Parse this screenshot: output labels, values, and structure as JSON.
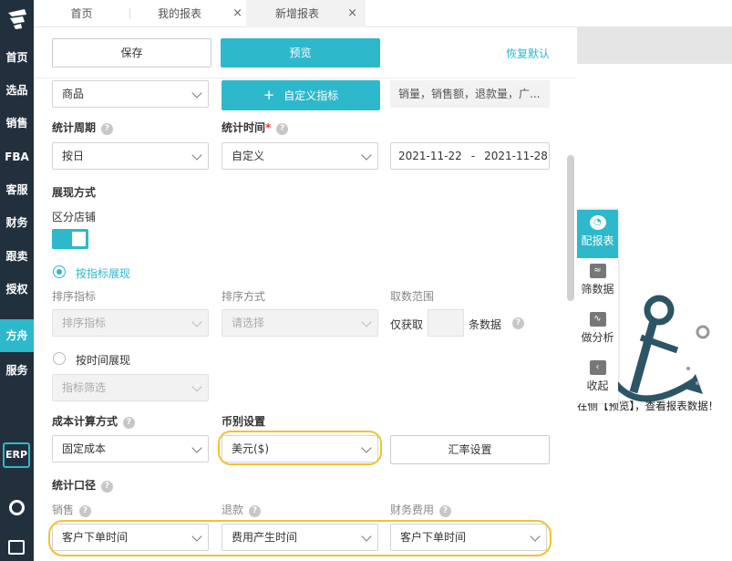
{
  "sidebar": {
    "items": [
      "首页",
      "选品",
      "销售",
      "FBA",
      "客服",
      "财务",
      "跟卖",
      "授权",
      "方舟",
      "服务"
    ],
    "active": "方舟",
    "erp": "ERP"
  },
  "tabs": [
    {
      "label": "首页"
    },
    {
      "label": "我的报表"
    },
    {
      "label": "新增报表"
    }
  ],
  "tab_close": "×",
  "toolbar": {
    "save": "保存",
    "preview": "预览",
    "reset": "恢复默认"
  },
  "row1": {
    "product": "商品",
    "custom_metric": "自定义指标",
    "plus": "+",
    "metrics_hint": "销量，销售额，退款量，广..."
  },
  "period": {
    "label": "统计周期",
    "value": "按日"
  },
  "time": {
    "label": "统计时间",
    "required": "*",
    "value": "自定义",
    "start": "2021-11-22",
    "sep": "-",
    "end": "2021-11-28"
  },
  "display": {
    "label": "展现方式",
    "split_store": "区分店铺"
  },
  "by_metric": {
    "label": "按指标展现",
    "sort_metric_label": "排序指标",
    "sort_metric_value": "排序指标",
    "sort_method_label": "排序方式",
    "sort_method_placeholder": "请选择",
    "range_label": "取数范围",
    "only_take": "仅获取",
    "count_suffix": "条数据"
  },
  "by_time": {
    "label": "按时间展现",
    "filter_placeholder": "指标筛选"
  },
  "cost": {
    "label": "成本计算方式",
    "value": "固定成本"
  },
  "currency": {
    "label": "币别设置",
    "value": "美元($)",
    "rate_button": "汇率设置"
  },
  "stat": {
    "label": "统计口径",
    "sales_label": "销售",
    "sales_value": "客户下单时间",
    "refund_label": "退款",
    "refund_value": "费用产生时间",
    "fin_label": "财务费用",
    "fin_value": "客户下单时间"
  },
  "floatbar": [
    {
      "label": "配报表",
      "icon": "pie-chart-icon"
    },
    {
      "label": "筛数据",
      "icon": "filter-data-icon"
    },
    {
      "label": "做分析",
      "icon": "analysis-icon"
    },
    {
      "label": "收起",
      "icon": "collapse-icon"
    }
  ],
  "preview_hint": "在侧【预览】，查看报表数据！",
  "help_mark": "?",
  "colors": {
    "accent": "#2eb8cc",
    "highlight": "#f2c230",
    "sidebar": "#22303d"
  }
}
